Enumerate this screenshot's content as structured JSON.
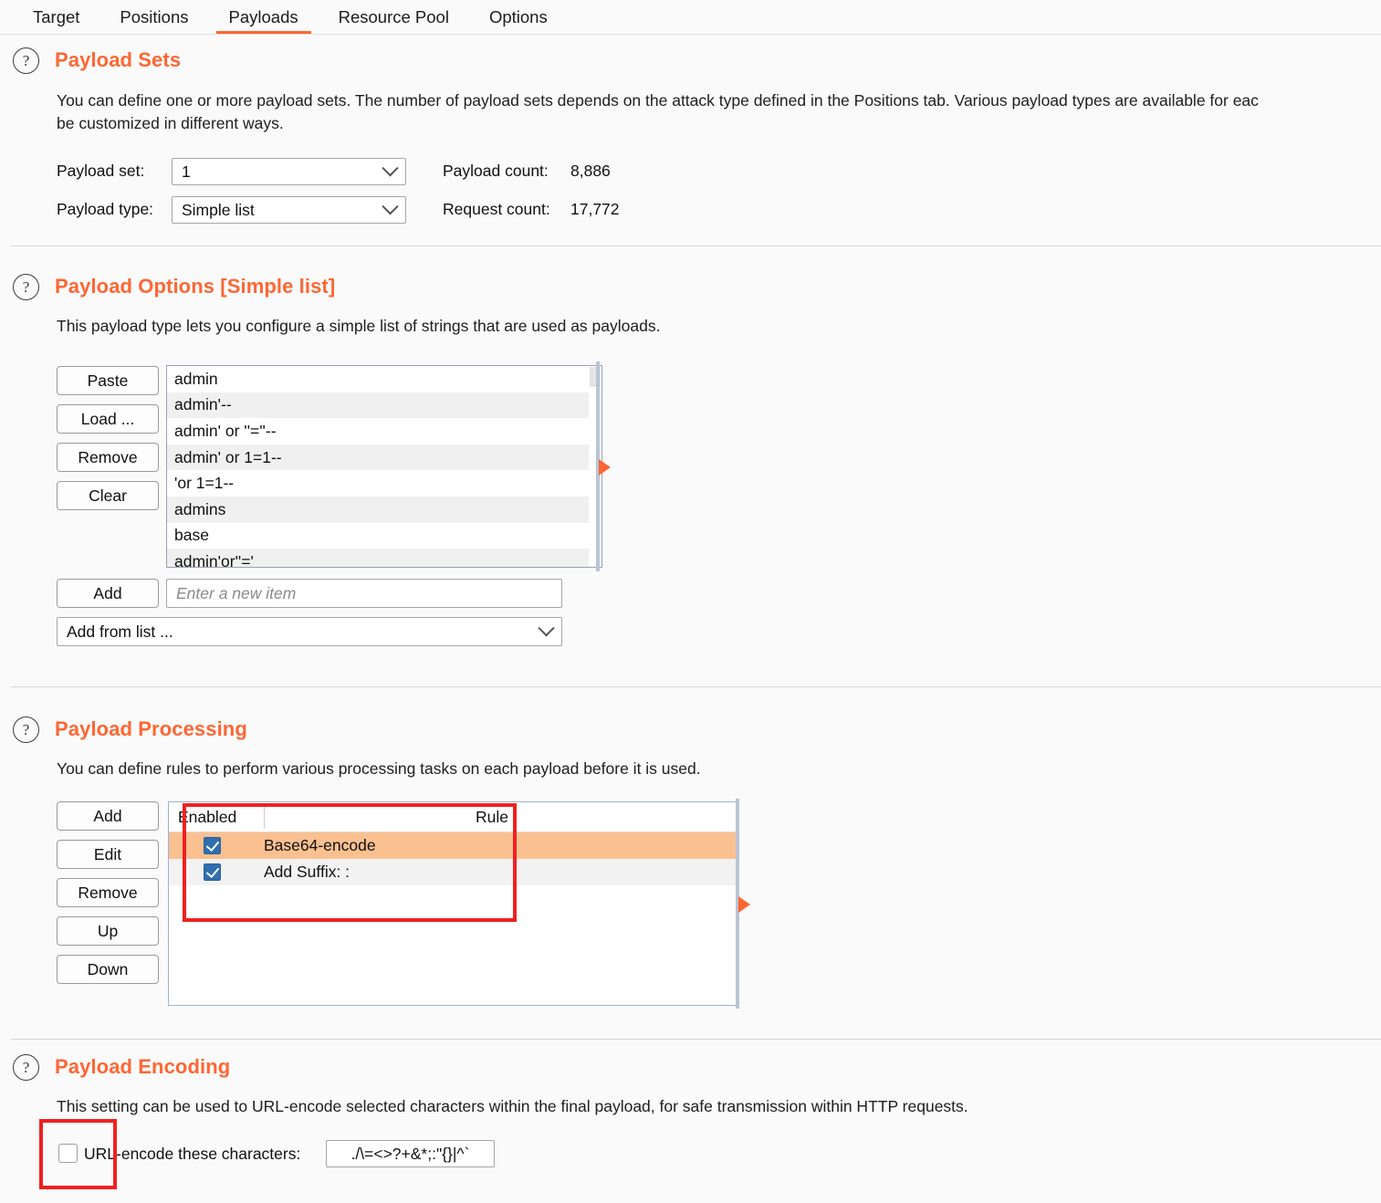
{
  "tabs": [
    {
      "label": "Target",
      "active": false
    },
    {
      "label": "Positions",
      "active": false
    },
    {
      "label": "Payloads",
      "active": true
    },
    {
      "label": "Resource Pool",
      "active": false
    },
    {
      "label": "Options",
      "active": false
    }
  ],
  "help_glyph": "?",
  "payload_sets": {
    "title": "Payload Sets",
    "description_line1": "You can define one or more payload sets. The number of payload sets depends on the attack type defined in the Positions tab. Various payload types are available for eac",
    "description_line2": "be customized in different ways.",
    "payload_set_label": "Payload set:",
    "payload_set_value": "1",
    "payload_type_label": "Payload type:",
    "payload_type_value": "Simple list",
    "payload_count_label": "Payload count:",
    "payload_count_value": "8,886",
    "request_count_label": "Request count:",
    "request_count_value": "17,772"
  },
  "payload_options": {
    "title": "Payload Options [Simple list]",
    "description": "This payload type lets you configure a simple list of strings that are used as payloads.",
    "buttons": [
      {
        "label": "Paste"
      },
      {
        "label": "Load ..."
      },
      {
        "label": "Remove"
      },
      {
        "label": "Clear"
      }
    ],
    "items": [
      "admin",
      "admin'--",
      "admin' or ''=''--",
      "admin' or 1=1--",
      "'or 1=1--",
      "admins",
      "base",
      "admin'or''='"
    ],
    "add_button": "Add",
    "add_placeholder": "Enter a new item",
    "add_from_list": "Add from list ..."
  },
  "payload_processing": {
    "title": "Payload Processing",
    "description": "You can define rules to perform various processing tasks on each payload before it is used.",
    "buttons": [
      {
        "label": "Add"
      },
      {
        "label": "Edit"
      },
      {
        "label": "Remove"
      },
      {
        "label": "Up"
      },
      {
        "label": "Down"
      }
    ],
    "columns": {
      "enabled": "Enabled",
      "rule": "Rule"
    },
    "rows": [
      {
        "enabled": true,
        "rule": "Base64-encode",
        "selected": true
      },
      {
        "enabled": true,
        "rule": "Add Suffix: :",
        "selected": false
      }
    ]
  },
  "payload_encoding": {
    "title": "Payload Encoding",
    "description": "This setting can be used to URL-encode selected characters within the final payload, for safe transmission within HTTP requests.",
    "checkbox_label": "URL-encode these characters:",
    "checkbox_checked": false,
    "characters_value": "./\\=<>?+&*;:\"{}|^`"
  },
  "colors": {
    "accent": "#ff6633",
    "selected_row": "#fac090",
    "checkbox_blue": "#2f6fad",
    "annotation_red": "#f02020",
    "splitter": "#b9c4d6"
  }
}
